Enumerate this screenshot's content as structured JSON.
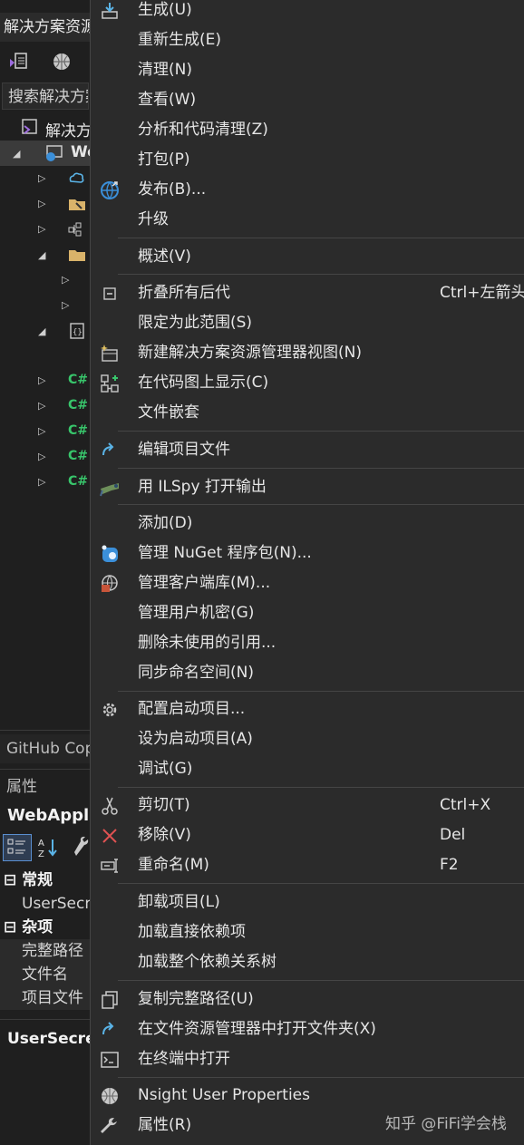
{
  "solution_explorer": {
    "title": "解决方案资源管理器",
    "search_placeholder": "搜索解决方案资源管理器",
    "solution_label": "解决方案",
    "project_label": "WebApplication",
    "file_marker": "C#"
  },
  "github_panel": {
    "label": "GitHub Copilot"
  },
  "properties_panel": {
    "title": "属性",
    "object_name": "WebApplication",
    "categories": [
      {
        "name": "常规",
        "items": [
          "UserSecretsId"
        ]
      },
      {
        "name": "杂项",
        "items": [
          "完整路径",
          "文件名",
          "项目文件"
        ]
      }
    ],
    "description_name": "UserSecretsId"
  },
  "context_menu": {
    "items": [
      {
        "icon": "build-icon",
        "label": "生成(U)",
        "shortcut": ""
      },
      {
        "icon": "",
        "label": "重新生成(E)",
        "shortcut": ""
      },
      {
        "icon": "",
        "label": "清理(N)",
        "shortcut": ""
      },
      {
        "icon": "",
        "label": "查看(W)",
        "shortcut": ""
      },
      {
        "icon": "",
        "label": "分析和代码清理(Z)",
        "shortcut": ""
      },
      {
        "icon": "",
        "label": "打包(P)",
        "shortcut": ""
      },
      {
        "icon": "globe-publish-icon",
        "label": "发布(B)...",
        "shortcut": ""
      },
      {
        "icon": "",
        "label": "升级",
        "shortcut": ""
      },
      {
        "icon": "",
        "label": "概述(V)",
        "shortcut": ""
      },
      {
        "icon": "collapse-all-icon",
        "label": "折叠所有后代",
        "shortcut": "Ctrl+左箭头"
      },
      {
        "icon": "",
        "label": "限定为此范围(S)",
        "shortcut": ""
      },
      {
        "icon": "new-explorer-view-icon",
        "label": "新建解决方案资源管理器视图(N)",
        "shortcut": ""
      },
      {
        "icon": "code-map-icon",
        "label": "在代码图上显示(C)",
        "shortcut": ""
      },
      {
        "icon": "",
        "label": "文件嵌套",
        "shortcut": ""
      },
      {
        "icon": "edit-project-file-icon",
        "label": "编辑项目文件",
        "shortcut": ""
      },
      {
        "icon": "ilspy-icon",
        "label": "用 ILSpy 打开输出",
        "shortcut": ""
      },
      {
        "icon": "",
        "label": "添加(D)",
        "shortcut": ""
      },
      {
        "icon": "nuget-icon",
        "label": "管理 NuGet 程序包(N)...",
        "shortcut": ""
      },
      {
        "icon": "client-library-icon",
        "label": "管理客户端库(M)...",
        "shortcut": ""
      },
      {
        "icon": "",
        "label": "管理用户机密(G)",
        "shortcut": ""
      },
      {
        "icon": "",
        "label": "删除未使用的引用...",
        "shortcut": ""
      },
      {
        "icon": "",
        "label": "同步命名空间(N)",
        "shortcut": ""
      },
      {
        "icon": "gear-icon",
        "label": "配置启动项目...",
        "shortcut": ""
      },
      {
        "icon": "",
        "label": "设为启动项目(A)",
        "shortcut": ""
      },
      {
        "icon": "",
        "label": "调试(G)",
        "shortcut": ""
      },
      {
        "icon": "scissors-icon",
        "label": "剪切(T)",
        "shortcut": "Ctrl+X"
      },
      {
        "icon": "remove-x-icon",
        "label": "移除(V)",
        "shortcut": "Del"
      },
      {
        "icon": "rename-icon",
        "label": "重命名(M)",
        "shortcut": "F2"
      },
      {
        "icon": "",
        "label": "卸载项目(L)",
        "shortcut": ""
      },
      {
        "icon": "",
        "label": "加载直接依赖项",
        "shortcut": ""
      },
      {
        "icon": "",
        "label": "加载整个依赖关系树",
        "shortcut": ""
      },
      {
        "icon": "copy-icon",
        "label": "复制完整路径(U)",
        "shortcut": ""
      },
      {
        "icon": "open-folder-arrow-icon",
        "label": "在文件资源管理器中打开文件夹(X)",
        "shortcut": ""
      },
      {
        "icon": "terminal-icon",
        "label": "在终端中打开",
        "shortcut": ""
      },
      {
        "icon": "nsight-globe-icon",
        "label": "Nsight User Properties",
        "shortcut": ""
      },
      {
        "icon": "wrench-icon",
        "label": "属性(R)",
        "shortcut": ""
      }
    ]
  },
  "watermark": "知乎 @FiFi学会栈"
}
